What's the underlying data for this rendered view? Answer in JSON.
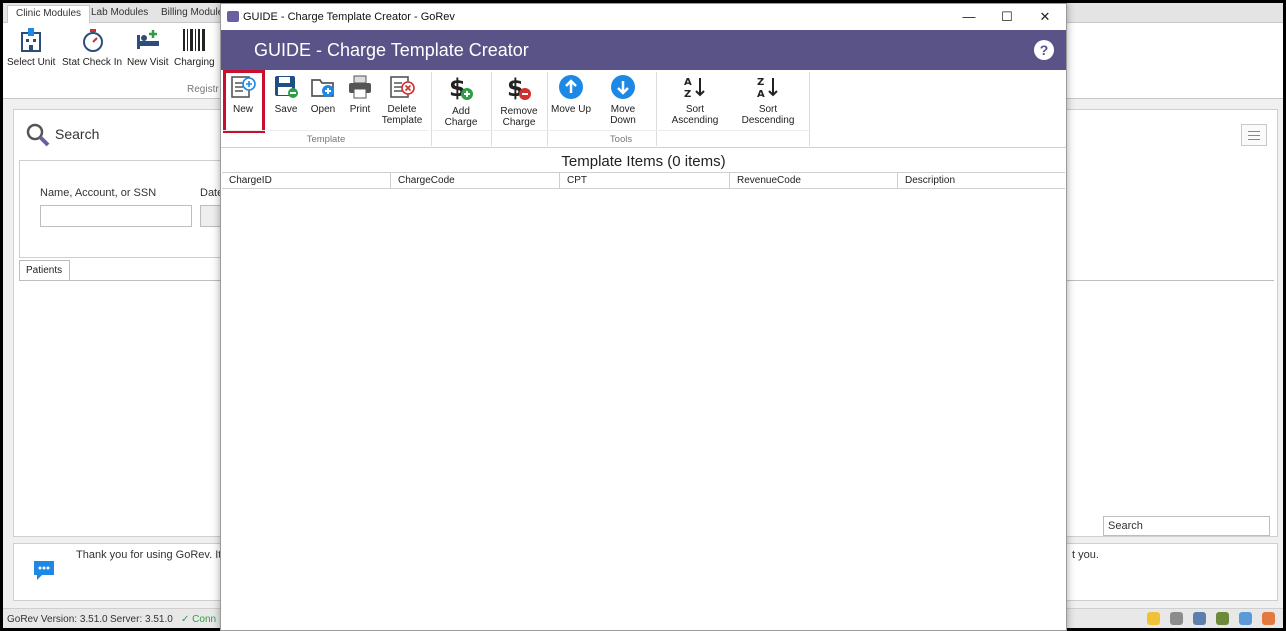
{
  "background": {
    "module_tabs": [
      "Clinic Modules",
      "Lab Modules",
      "Billing Modules"
    ],
    "ribbon_buttons": [
      "Select Unit",
      "Stat Check In",
      "New Visit",
      "Charging"
    ],
    "group_label": "Registr",
    "search_title": "Search",
    "name_label": "Name, Account, or SSN",
    "date_label": "Date",
    "patients_tab": "Patients",
    "search_box_placeholder": "Search",
    "message_left": "Thank you for using GoRev.  It",
    "message_right": "t you.",
    "status_version": "GoRev Version: 3.51.0",
    "status_server": "Server: 3.51.0",
    "status_conn": "✓ Conn"
  },
  "dialog": {
    "window_title": "GUIDE - Charge Template Creator - GoRev",
    "banner_title": "GUIDE - Charge Template Creator",
    "help_label": "?",
    "ribbon": {
      "new": "New",
      "save": "Save",
      "open": "Open",
      "print": "Print",
      "delete_line1": "Delete",
      "delete_line2": "Template",
      "add_charge": "Add Charge",
      "remove_line1": "Remove",
      "remove_line2": "Charge",
      "move_up": "Move Up",
      "move_down": "Move Down",
      "sort_asc": "Sort Ascending",
      "sort_desc": "Sort Descending",
      "group_template": "Template",
      "group_tools": "Tools"
    },
    "items_title": "Template Items (0 items)",
    "columns": [
      "ChargeID",
      "ChargeCode",
      "CPT",
      "RevenueCode",
      "Description"
    ]
  },
  "colors": {
    "banner": "#5a5388",
    "highlight": "#c8102e",
    "accent_blue": "#1e88e5",
    "accent_green": "#2e9e44",
    "accent_red": "#d32f2f"
  }
}
